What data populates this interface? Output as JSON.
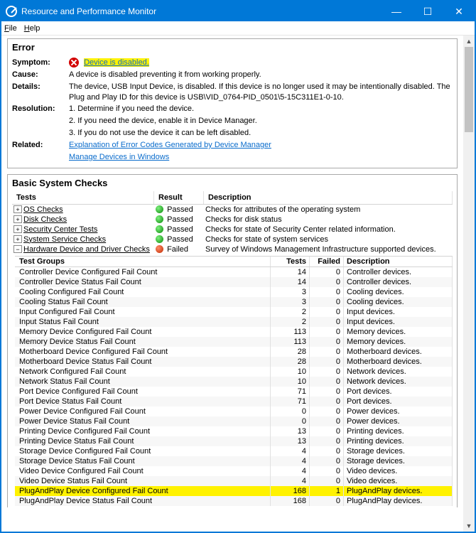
{
  "window": {
    "title": "Resource and Performance Monitor",
    "menu": {
      "file": "File",
      "help": "Help"
    },
    "buttons": {
      "min": "—",
      "max": "☐",
      "close": "✕"
    }
  },
  "error_panel": {
    "header": "Error",
    "rows": {
      "symptom_label": "Symptom:",
      "symptom_value": "Device is disabled.",
      "cause_label": "Cause:",
      "cause_value": "A device is disabled preventing it from working properly.",
      "details_label": "Details:",
      "details_value": "The device, USB Input Device, is disabled. If this device is no longer used it may be intentionally disabled. The Plug and Play ID for this device is USB\\VID_0764-PID_0501\\5-15C311E1-0-10.",
      "resolution_label": "Resolution:",
      "resolution_1": "1. Determine if you need the device.",
      "resolution_2": "2. If you need the device, enable it in Device Manager.",
      "resolution_3": "3. If you do not use the device it can be left disabled.",
      "related_label": "Related:",
      "related_link_1": "Explanation of Error Codes Generated by Device Manager",
      "related_link_2": "Manage Devices in Windows"
    }
  },
  "checks_panel": {
    "header": "Basic System Checks",
    "columns": {
      "tests": "Tests",
      "result": "Result",
      "description": "Description"
    },
    "rows": [
      {
        "name": "OS Checks",
        "result": "Passed",
        "status": "green",
        "desc": "Checks for attributes of the operating system",
        "exp": "+"
      },
      {
        "name": "Disk Checks",
        "result": "Passed",
        "status": "green",
        "desc": "Checks for disk status",
        "exp": "+"
      },
      {
        "name": "Security Center Tests",
        "result": "Passed",
        "status": "green",
        "desc": "Checks for state of Security Center related information.",
        "exp": "+"
      },
      {
        "name": "System Service Checks",
        "result": "Passed",
        "status": "green",
        "desc": "Checks for state of system services",
        "exp": "+"
      },
      {
        "name": "Hardware Device and Driver Checks",
        "result": "Failed",
        "status": "red",
        "desc": "Survey of Windows Management Infrastructure supported devices.",
        "exp": "−"
      }
    ],
    "sub_columns": {
      "groups": "Test Groups",
      "tests": "Tests",
      "failed": "Failed",
      "description": "Description"
    },
    "sub_rows": [
      {
        "name": "Controller Device Configured Fail Count",
        "tests": 14,
        "failed": 0,
        "desc": "Controller devices."
      },
      {
        "name": "Controller Device Status Fail Count",
        "tests": 14,
        "failed": 0,
        "desc": "Controller devices."
      },
      {
        "name": "Cooling Configured Fail Count",
        "tests": 3,
        "failed": 0,
        "desc": "Cooling devices."
      },
      {
        "name": "Cooling Status Fail Count",
        "tests": 3,
        "failed": 0,
        "desc": "Cooling devices."
      },
      {
        "name": "Input Configured Fail Count",
        "tests": 2,
        "failed": 0,
        "desc": "Input devices."
      },
      {
        "name": "Input Status Fail Count",
        "tests": 2,
        "failed": 0,
        "desc": "Input devices."
      },
      {
        "name": "Memory Device Configured Fail Count",
        "tests": 113,
        "failed": 0,
        "desc": "Memory devices."
      },
      {
        "name": "Memory Device Status Fail Count",
        "tests": 113,
        "failed": 0,
        "desc": "Memory devices."
      },
      {
        "name": "Motherboard Device Configured Fail Count",
        "tests": 28,
        "failed": 0,
        "desc": "Motherboard devices."
      },
      {
        "name": "Motherboard Device Status Fail Count",
        "tests": 28,
        "failed": 0,
        "desc": "Motherboard devices."
      },
      {
        "name": "Network Configured Fail Count",
        "tests": 10,
        "failed": 0,
        "desc": "Network devices."
      },
      {
        "name": "Network Status Fail Count",
        "tests": 10,
        "failed": 0,
        "desc": "Network devices."
      },
      {
        "name": "Port Device Configured Fail Count",
        "tests": 71,
        "failed": 0,
        "desc": "Port devices."
      },
      {
        "name": "Port Device Status Fail Count",
        "tests": 71,
        "failed": 0,
        "desc": "Port devices."
      },
      {
        "name": "Power Device Configured Fail Count",
        "tests": 0,
        "failed": 0,
        "desc": "Power devices."
      },
      {
        "name": "Power Device Status Fail Count",
        "tests": 0,
        "failed": 0,
        "desc": "Power devices."
      },
      {
        "name": "Printing Device Configured Fail Count",
        "tests": 13,
        "failed": 0,
        "desc": "Printing devices."
      },
      {
        "name": "Printing Device Status Fail Count",
        "tests": 13,
        "failed": 0,
        "desc": "Printing devices."
      },
      {
        "name": "Storage Device Configured Fail Count",
        "tests": 4,
        "failed": 0,
        "desc": "Storage devices."
      },
      {
        "name": "Storage Device Status Fail Count",
        "tests": 4,
        "failed": 0,
        "desc": "Storage devices."
      },
      {
        "name": "Video Device Configured Fail Count",
        "tests": 4,
        "failed": 0,
        "desc": "Video devices."
      },
      {
        "name": "Video Device Status Fail Count",
        "tests": 4,
        "failed": 0,
        "desc": "Video devices."
      },
      {
        "name": "PlugAndPlay Device Configured Fail Count",
        "tests": 168,
        "failed": 1,
        "desc": "PlugAndPlay devices.",
        "hl": true
      },
      {
        "name": "PlugAndPlay Device Status Fail Count",
        "tests": 168,
        "failed": 0,
        "desc": "PlugAndPlay devices."
      }
    ]
  }
}
